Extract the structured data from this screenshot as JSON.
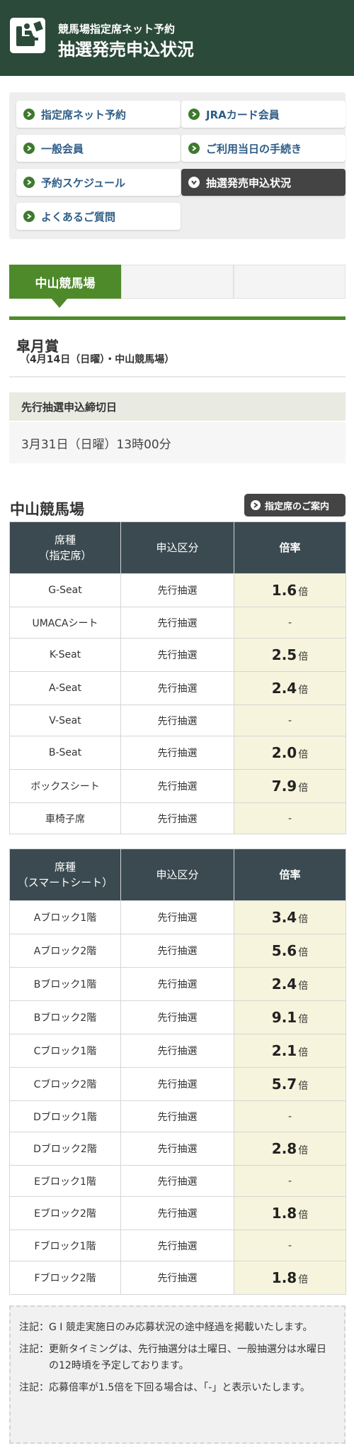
{
  "header": {
    "subtitle": "競馬場指定席ネット予約",
    "title": "抽選発売申込状況",
    "icon": "seat-person-icon"
  },
  "nav": {
    "items": [
      {
        "label": "指定席ネット予約",
        "active": false
      },
      {
        "label": "JRAカード会員",
        "active": false
      },
      {
        "label": "一般会員",
        "active": false
      },
      {
        "label": "ご利用当日の手続き",
        "active": false
      },
      {
        "label": "予約スケジュール",
        "active": false
      },
      {
        "label": "抽選発売申込状況",
        "active": true
      },
      {
        "label": "よくあるご質問",
        "active": false
      }
    ]
  },
  "tabs": {
    "active_label": "中山競馬場"
  },
  "race": {
    "name": "皐月賞",
    "date": "（4月14日（日曜）・中山競馬場）"
  },
  "deadline": {
    "label": "先行抽選申込締切日",
    "value": "3月31日（日曜）13時00分"
  },
  "venue": {
    "name": "中山競馬場",
    "guide_button": "指定席のご案内"
  },
  "table1": {
    "headers": [
      "席種\n（指定席）",
      "申込区分",
      "倍率"
    ],
    "rows": [
      {
        "seat": "G-Seat",
        "type": "先行抽選",
        "rate": "1.6",
        "unit": "倍"
      },
      {
        "seat": "UMACAシート",
        "type": "先行抽選",
        "rate": "-",
        "unit": ""
      },
      {
        "seat": "K-Seat",
        "type": "先行抽選",
        "rate": "2.5",
        "unit": "倍"
      },
      {
        "seat": "A-Seat",
        "type": "先行抽選",
        "rate": "2.4",
        "unit": "倍"
      },
      {
        "seat": "V-Seat",
        "type": "先行抽選",
        "rate": "-",
        "unit": ""
      },
      {
        "seat": "B-Seat",
        "type": "先行抽選",
        "rate": "2.0",
        "unit": "倍"
      },
      {
        "seat": "ボックスシート",
        "type": "先行抽選",
        "rate": "7.9",
        "unit": "倍"
      },
      {
        "seat": "車椅子席",
        "type": "先行抽選",
        "rate": "-",
        "unit": ""
      }
    ]
  },
  "table2": {
    "headers": [
      "席種\n（スマートシート）",
      "申込区分",
      "倍率"
    ],
    "rows": [
      {
        "seat": "Aブロック1階",
        "type": "先行抽選",
        "rate": "3.4",
        "unit": "倍"
      },
      {
        "seat": "Aブロック2階",
        "type": "先行抽選",
        "rate": "5.6",
        "unit": "倍"
      },
      {
        "seat": "Bブロック1階",
        "type": "先行抽選",
        "rate": "2.4",
        "unit": "倍"
      },
      {
        "seat": "Bブロック2階",
        "type": "先行抽選",
        "rate": "9.1",
        "unit": "倍"
      },
      {
        "seat": "Cブロック1階",
        "type": "先行抽選",
        "rate": "2.1",
        "unit": "倍"
      },
      {
        "seat": "Cブロック2階",
        "type": "先行抽選",
        "rate": "5.7",
        "unit": "倍"
      },
      {
        "seat": "Dブロック1階",
        "type": "先行抽選",
        "rate": "-",
        "unit": ""
      },
      {
        "seat": "Dブロック2階",
        "type": "先行抽選",
        "rate": "2.8",
        "unit": "倍"
      },
      {
        "seat": "Eブロック1階",
        "type": "先行抽選",
        "rate": "-",
        "unit": ""
      },
      {
        "seat": "Eブロック2階",
        "type": "先行抽選",
        "rate": "1.8",
        "unit": "倍"
      },
      {
        "seat": "Fブロック1階",
        "type": "先行抽選",
        "rate": "-",
        "unit": ""
      },
      {
        "seat": "Fブロック2階",
        "type": "先行抽選",
        "rate": "1.8",
        "unit": "倍"
      }
    ]
  },
  "notes": [
    {
      "label": "注記：",
      "text": "G I 競走実施日のみ応募状況の途中経過を掲載いたします。"
    },
    {
      "label": "注記：",
      "text": "更新タイミングは、先行抽選分は土曜日、一般抽選分は水曜日の12時頃を予定しております。"
    },
    {
      "label": "注記：",
      "text": "応募倍率が1.5倍を下回る場合は、「-」と表示いたします。"
    }
  ],
  "colors": {
    "header_bg": "#2b4a3a",
    "accent_green": "#4e8a2a",
    "table_header": "#3b4a50",
    "rate_cell": "#f6f4dc",
    "link_blue": "#2f5d86"
  }
}
